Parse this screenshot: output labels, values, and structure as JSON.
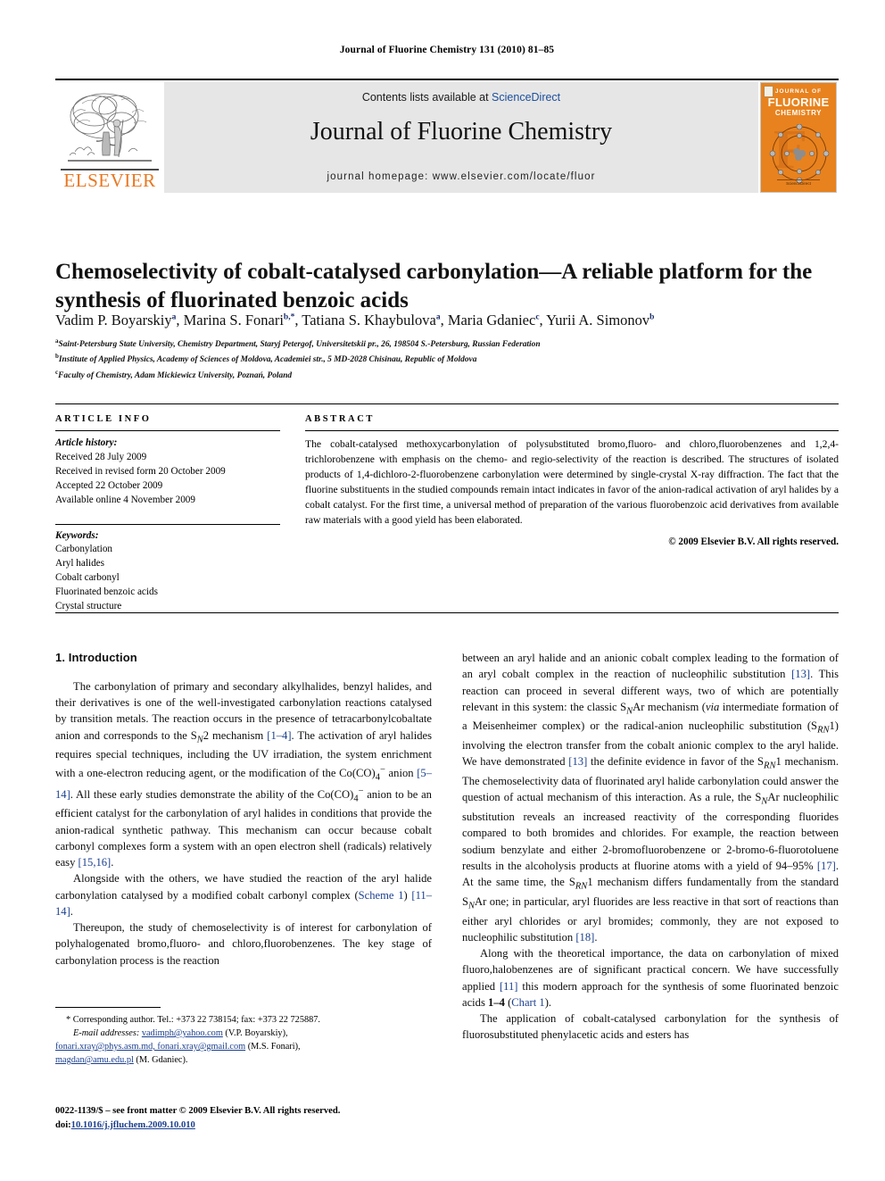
{
  "running_head": "Journal of Fluorine Chemistry 131 (2010) 81–85",
  "masthead": {
    "contents_prefix": "Contents lists available at ",
    "contents_link": "ScienceDirect",
    "journal_title": "Journal of Fluorine Chemistry",
    "homepage": "journal homepage: www.elsevier.com/locate/fluor",
    "publisher_wordmark": "ELSEVIER",
    "cover": {
      "line1": "JOURNAL OF",
      "line2": "FLUORINE",
      "line3": "CHEMISTRY",
      "letter": "F",
      "footer": "ScienceDirect"
    }
  },
  "article": {
    "title": "Chemoselectivity of cobalt-catalysed carbonylation—A reliable platform for the synthesis of fluorinated benzoic acids",
    "authors": [
      {
        "name": "Vadim P. Boyarskiy",
        "marks": "a"
      },
      {
        "name": "Marina S. Fonari",
        "marks": "b,*"
      },
      {
        "name": "Tatiana S. Khaybulova",
        "marks": "a"
      },
      {
        "name": "Maria Gdaniec",
        "marks": "c"
      },
      {
        "name": "Yurii A. Simonov",
        "marks": "b"
      }
    ],
    "affiliations": [
      {
        "mark": "a",
        "text": "Saint-Petersburg State University, Chemistry Department, Staryj Petergof, Universitetskii pr., 26, 198504 S.-Petersburg, Russian Federation"
      },
      {
        "mark": "b",
        "text": "Institute of Applied Physics, Academy of Sciences of Moldova, Academiei str., 5 MD-2028 Chisinau, Republic of Moldova"
      },
      {
        "mark": "c",
        "text": "Faculty of Chemistry, Adam Mickiewicz University, Poznań, Poland"
      }
    ]
  },
  "article_info": {
    "heading": "ARTICLE INFO",
    "history_label": "Article history:",
    "history": [
      "Received 28 July 2009",
      "Received in revised form 20 October 2009",
      "Accepted 22 October 2009",
      "Available online 4 November 2009"
    ],
    "keywords_label": "Keywords:",
    "keywords": [
      "Carbonylation",
      "Aryl halides",
      "Cobalt carbonyl",
      "Fluorinated benzoic acids",
      "Crystal structure"
    ]
  },
  "abstract": {
    "heading": "ABSTRACT",
    "text": "The cobalt-catalysed methoxycarbonylation of polysubstituted bromo,fluoro- and chloro,fluorobenzenes and 1,2,4-trichlorobenzene with emphasis on the chemo- and regio-selectivity of the reaction is described. The structures of isolated products of 1,4-dichloro-2-fluorobenzene carbonylation were determined by single-crystal X-ray diffraction. The fact that the fluorine substituents in the studied compounds remain intact indicates in favor of the anion-radical activation of aryl halides by a cobalt catalyst. For the first time, a universal method of preparation of the various fluorobenzoic acid derivatives from available raw materials with a good yield has been elaborated.",
    "rights": "© 2009 Elsevier B.V. All rights reserved."
  },
  "body": {
    "section_heading": "1. Introduction",
    "left_paragraphs": [
      "The carbonylation of primary and secondary alkylhalides, benzyl halides, and their derivatives is one of the well-investigated carbonylation reactions catalysed by transition metals. The reaction occurs in the presence of tetracarbonylcobaltate anion and corresponds to the SN2 mechanism [1–4]. The activation of aryl halides requires special techniques, including the UV irradiation, the system enrichment with a one-electron reducing agent, or the modification of the Co(CO)4− anion [5–14]. All these early studies demonstrate the ability of the Co(CO)4− anion to be an efficient catalyst for the carbonylation of aryl halides in conditions that provide the anion-radical synthetic pathway. This mechanism can occur because cobalt carbonyl complexes form a system with an open electron shell (radicals) relatively easy [15,16].",
      "Alongside with the others, we have studied the reaction of the aryl halide carbonylation catalysed by a modified cobalt carbonyl complex (Scheme 1) [11–14].",
      "Thereupon, the study of chemoselectivity is of interest for carbonylation of polyhalogenated bromo,fluoro- and chloro,fluorobenzenes. The key stage of carbonylation process is the reaction"
    ],
    "right_paragraphs": [
      "between an aryl halide and an anionic cobalt complex leading to the formation of an aryl cobalt complex in the reaction of nucleophilic substitution [13]. This reaction can proceed in several different ways, two of which are potentially relevant in this system: the classic SNAr mechanism (via intermediate formation of a Meisenheimer complex) or the radical-anion nucleophilic substitution (SRN1) involving the electron transfer from the cobalt anionic complex to the aryl halide. We have demonstrated [13] the definite evidence in favor of the SRN1 mechanism. The chemoselectivity data of fluorinated aryl halide carbonylation could answer the question of actual mechanism of this interaction. As a rule, the SNAr nucleophilic substitution reveals an increased reactivity of the corresponding fluorides compared to both bromides and chlorides. For example, the reaction between sodium benzylate and either 2-bromofluorobenzene or 2-bromo-6-fluorotoluene results in the alcoholysis products at fluorine atoms with a yield of 94–95% [17]. At the same time, the SRN1 mechanism differs fundamentally from the standard SNAr one; in particular, aryl fluorides are less reactive in that sort of reactions than either aryl chlorides or aryl bromides; commonly, they are not exposed to nucleophilic substitution [18].",
      "Along with the theoretical importance, the data on carbonylation of mixed fluoro,halobenzenes are of significant practical concern. We have successfully applied [11] this modern approach for the synthesis of some fluorinated benzoic acids 1–4 (Chart 1).",
      "The application of cobalt-catalysed carbonylation for the synthesis of fluorosubstituted phenylacetic acids and esters has"
    ]
  },
  "footnote": {
    "star": "*",
    "corresponding": "Corresponding author. Tel.: +373 22 738154; fax: +373 22 725887.",
    "email_label": "E-mail addresses:",
    "emails": [
      {
        "address": "vadimph@yahoo.com",
        "who": "(V.P. Boyarskiy),"
      },
      {
        "address": "fonari.xray@phys.asm.md, fonari.xray@gmail.com",
        "who": "(M.S. Fonari),"
      },
      {
        "address": "magdan@amu.edu.pl",
        "who": "(M. Gdaniec)."
      }
    ]
  },
  "colophon": {
    "line1": "0022-1139/$ – see front matter © 2009 Elsevier B.V. All rights reserved.",
    "doi_label": "doi:",
    "doi": "10.1016/j.jfluchem.2009.10.010"
  },
  "colors": {
    "link": "#1b3f8f",
    "sciencedirect": "#1c4f9c",
    "elsevier_orange": "#E87722",
    "cover_orange": "#E8821E",
    "band_gray": "#e6e6e6"
  }
}
